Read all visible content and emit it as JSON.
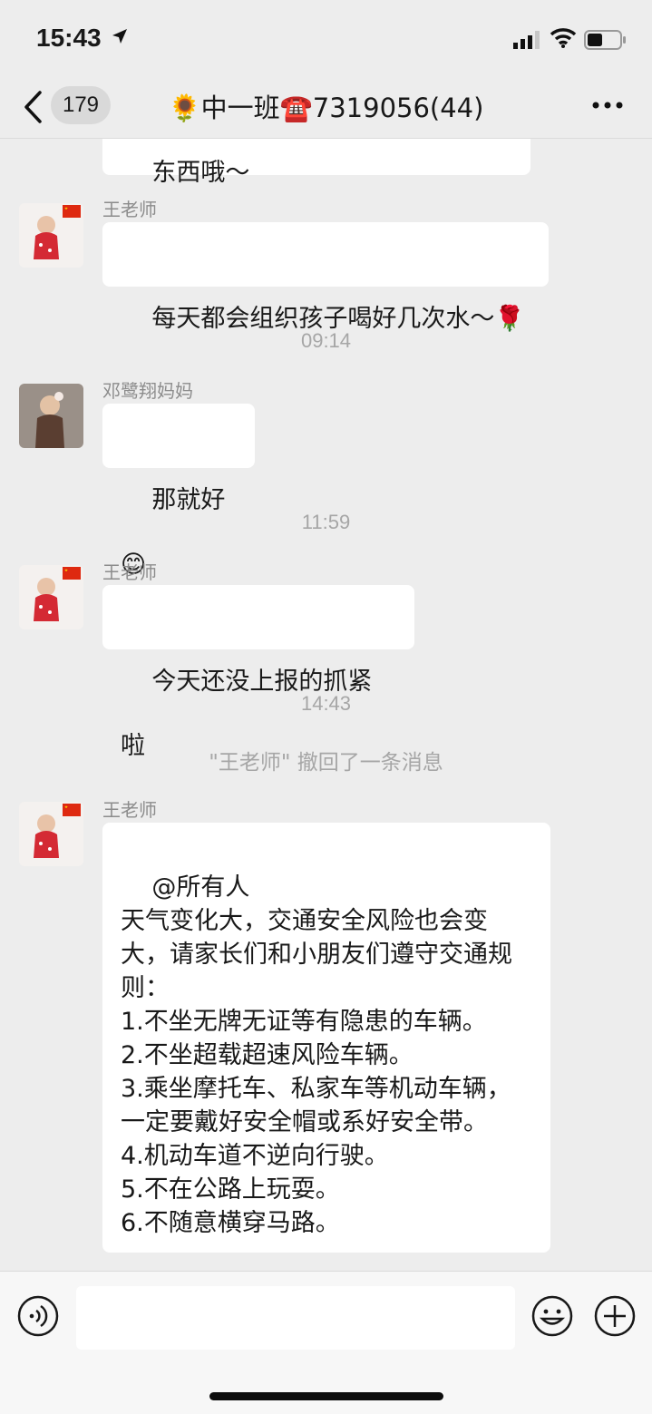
{
  "status": {
    "time": "15:43"
  },
  "nav": {
    "badge": "179",
    "title": "🌻中一班☎️7319056(44)"
  },
  "messages": [
    {
      "text": "东西哦～"
    },
    {
      "sender": "王老师",
      "text": "每天都会组织孩子喝好几次水～🌹"
    },
    {
      "timestamp": "09:14"
    },
    {
      "sender": "邓鹭翔妈妈",
      "text": "那就好😊"
    },
    {
      "timestamp": "11:59"
    },
    {
      "sender": "王老师",
      "text": "今天还没上报的抓紧啦"
    },
    {
      "timestamp": "14:43"
    },
    {
      "system": "\"王老师\" 撤回了一条消息"
    },
    {
      "sender": "王老师",
      "text": "@所有人\n天气变化大，交通安全风险也会变大，请家长们和小朋友们遵守交通规则：\n1.不坐无牌无证等有隐患的车辆。\n2.不坐超载超速风险车辆。\n3.乘坐摩托车、私家车等机动车辆，一定要戴好安全帽或系好安全带。\n4.机动车道不逆向行驶。\n5.不在公路上玩耍。\n6.不随意横穿马路。"
    }
  ],
  "icons": {
    "back": "chevron-left-icon",
    "more": "more-icon",
    "voice": "voice-icon",
    "emoji": "emoji-icon",
    "plus": "plus-icon",
    "flag": "china-flag-icon"
  },
  "colors": {
    "background": "#ededed",
    "bubble": "#ffffff",
    "meta": "#a6a6a6"
  }
}
